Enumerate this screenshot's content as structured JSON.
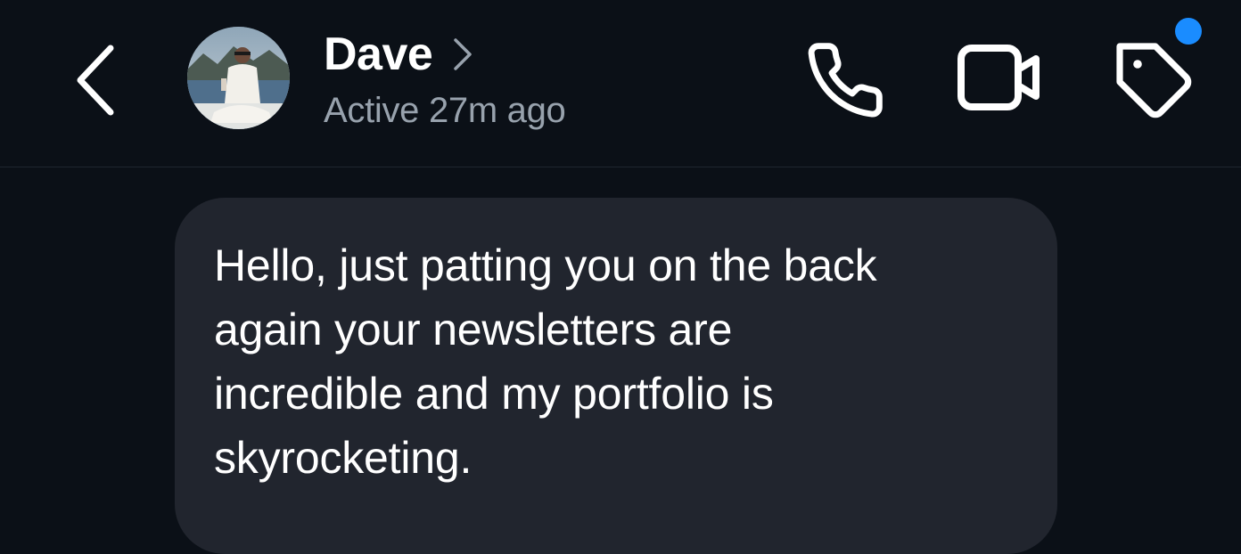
{
  "header": {
    "back_icon": "chevron-left-icon",
    "contact": {
      "name": "Dave",
      "status": "Active 27m ago",
      "chevron_icon": "chevron-right-icon"
    },
    "actions": [
      {
        "name": "phone-call",
        "icon": "phone-icon"
      },
      {
        "name": "video-call",
        "icon": "video-camera-icon"
      },
      {
        "name": "tag",
        "icon": "tag-icon",
        "has_notification": true
      }
    ]
  },
  "messages": [
    {
      "direction": "incoming",
      "text": "Hello, just patting you on the back\nagain your newsletters are\nincredible and my portfolio is\nskyrocketing."
    }
  ],
  "colors": {
    "background": "#0b1017",
    "bubble": "#21252e",
    "status_text": "#98a2ad",
    "notification_dot": "#1a8cff",
    "divider": "#1f2630"
  }
}
